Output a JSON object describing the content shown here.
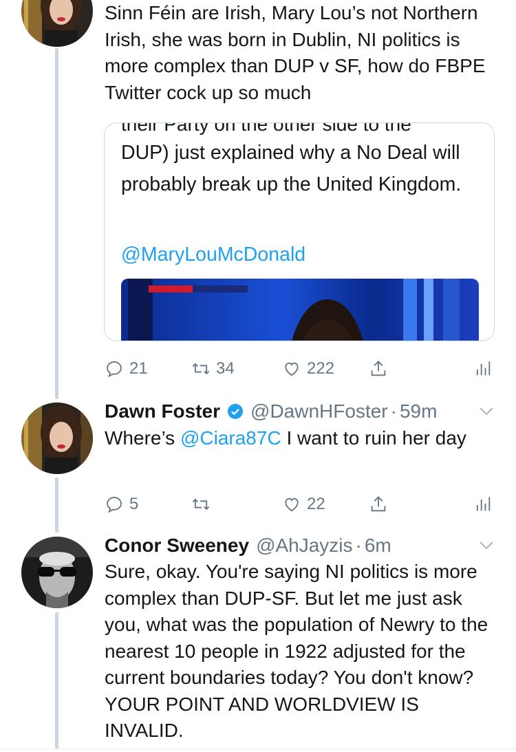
{
  "colors": {
    "accent": "#1da1f2",
    "text": "#14171a",
    "muted": "#657786",
    "border": "#ccd6dd"
  },
  "tweet1": {
    "text": "Sinn Féin are Irish, Mary Lou’s not Northern Irish, she was born in Dublin, NI politics is more complex than DUP v SF, how do FBPE Twitter cock up so much",
    "quote": {
      "cut_line": "their Party on the other side to the",
      "text": "DUP) just explained why a No Deal will probably break up the United Kingdom.",
      "mention": "@MaryLouMcDonald",
      "video_icon": "sky-news-video-thumbnail"
    },
    "actions": {
      "replies": "21",
      "retweets": "34",
      "likes": "222"
    }
  },
  "tweet2": {
    "name": "Dawn Foster",
    "verified_icon": "verified-badge-icon",
    "handle": "@DawnHFoster",
    "dot": "·",
    "time": "59m",
    "text_before": "Where’s ",
    "mention": "@Ciara87C",
    "text_after": " I want to ruin her day",
    "actions": {
      "replies": "5",
      "retweets": "",
      "likes": "22"
    }
  },
  "tweet3": {
    "name": "Conor Sweeney",
    "handle": "@AhJayzis",
    "dot": "·",
    "time": "6m",
    "text": "Sure, okay. You're saying NI politics is more complex than DUP-SF. But let me just ask you, what was the population of Newry to the nearest 10 people in 1922 adjusted for the current boundaries today? You don't know? YOUR POINT AND WORLDVIEW IS INVALID."
  },
  "icons": {
    "reply": "reply-icon",
    "retweet": "retweet-icon",
    "like": "heart-icon",
    "share": "share-icon",
    "analytics": "analytics-icon",
    "caret": "chevron-down-icon"
  }
}
